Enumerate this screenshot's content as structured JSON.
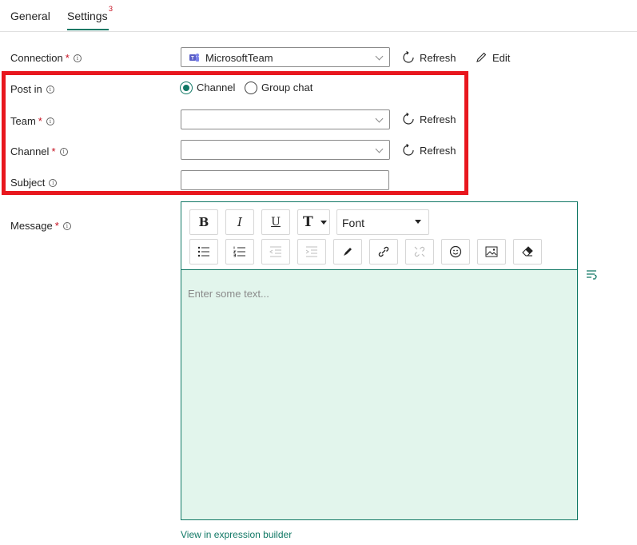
{
  "tabs": [
    {
      "label": "General"
    },
    {
      "label": "Settings",
      "badge": "3",
      "active": true
    }
  ],
  "form": {
    "connection": {
      "label": "Connection",
      "required": "*",
      "value": "MicrosoftTeam",
      "refresh": "Refresh",
      "edit": "Edit"
    },
    "post_in": {
      "label": "Post in",
      "options": [
        "Channel",
        "Group chat"
      ],
      "selected": "Channel"
    },
    "team": {
      "label": "Team",
      "required": "*",
      "value": "",
      "refresh": "Refresh"
    },
    "channel": {
      "label": "Channel",
      "required": "*",
      "value": "",
      "refresh": "Refresh"
    },
    "subject": {
      "label": "Subject",
      "value": ""
    },
    "message": {
      "label": "Message",
      "required": "*",
      "placeholder": "Enter some text..."
    }
  },
  "editor": {
    "bold": "B",
    "italic": "I",
    "underline": "U",
    "text_size": "T",
    "font_select": "Font"
  },
  "footer": {
    "expression_link": "View in expression builder"
  },
  "colors": {
    "accent": "#117865",
    "required": "#c50f1f",
    "highlight": "#e8171e",
    "editor_bg": "#e2f5ec"
  }
}
